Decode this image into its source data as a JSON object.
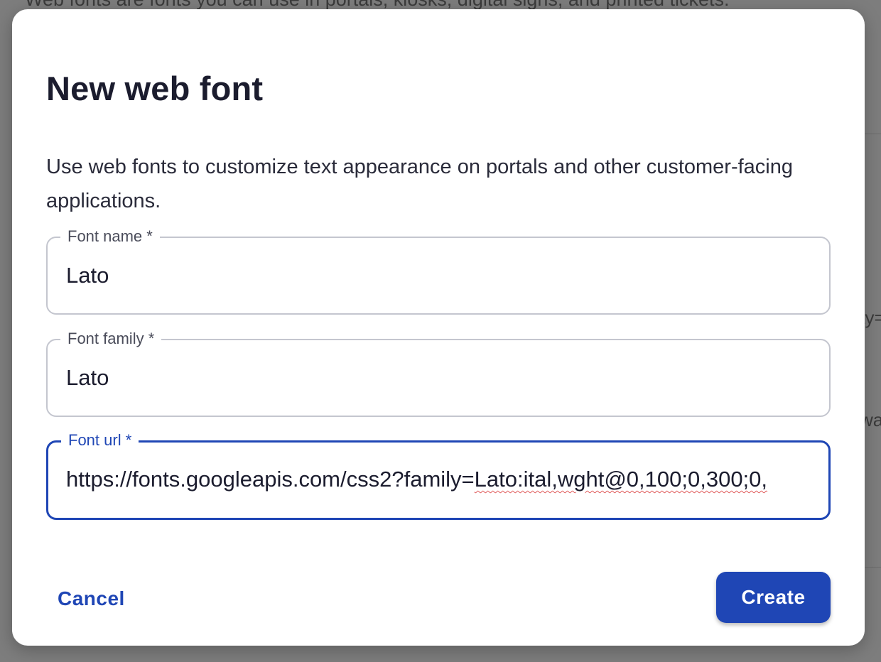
{
  "background": {
    "top_text": "Web fonts are fonts you can use in portals, kiosks, digital signs, and printed tickets.",
    "fragment_1": "ay=",
    "fragment_2": "wa"
  },
  "dialog": {
    "title": "New web font",
    "description": "Use web fonts to customize text appearance on portals and other customer-facing applications.",
    "fields": {
      "font_name": {
        "label": "Font name *",
        "value": "Lato"
      },
      "font_family": {
        "label": "Font family *",
        "value": "Lato"
      },
      "font_url": {
        "label": "Font url *",
        "value_prefix": "https://fonts.googleapis.com/css2?family=",
        "value_flagged": "Lato:ital,wght@0,100;0,300;0,"
      }
    },
    "cancel_label": "Cancel",
    "create_label": "Create"
  },
  "colors": {
    "accent": "#1f46b5",
    "scrim": "#7d7d7d",
    "field_border": "#c4c6cf",
    "spellcheck": "#e05a5a"
  }
}
